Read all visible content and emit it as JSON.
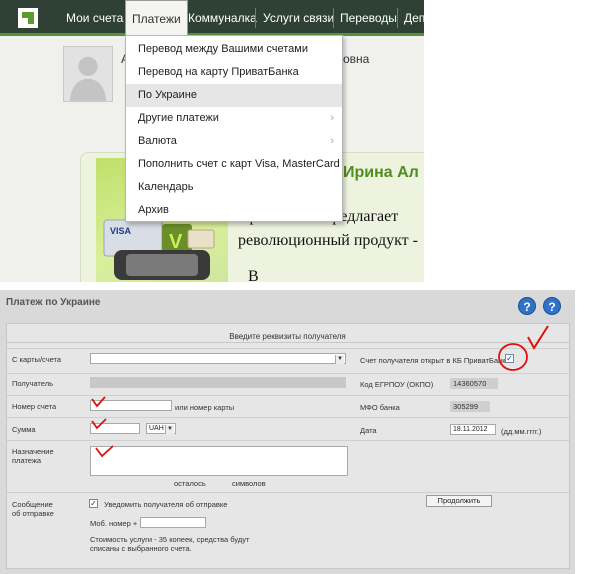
{
  "nav": {
    "items": [
      "Мои счета",
      "Платежи",
      "Коммуналка",
      "Услуги связи",
      "Переводы",
      "Деп"
    ],
    "active_index": 1
  },
  "dropdown": {
    "items": [
      {
        "label": "Перевод между Вашими счетами",
        "has_submenu": false
      },
      {
        "label": "Перевод на карту ПриватБанка",
        "has_submenu": false
      },
      {
        "label": "По Украине",
        "has_submenu": false,
        "highlighted": true
      },
      {
        "label": "Другие платежи",
        "has_submenu": true
      },
      {
        "label": "Валюта",
        "has_submenu": true
      },
      {
        "label": "Пополнить счет с карт Visa, MasterCard",
        "has_submenu": false
      },
      {
        "label": "Календарь",
        "has_submenu": false
      },
      {
        "label": "Архив",
        "has_submenu": false
      }
    ]
  },
  "profile": {
    "name_fragment_left": "А",
    "name_fragment_right": "овна"
  },
  "banner": {
    "name": "Ирина Ал",
    "text_line1": "ПриватБанк предлагает",
    "text_line2": "революционный продукт -",
    "text_line3": "В"
  },
  "form": {
    "title": "Платеж по Украине",
    "heading": "Введите реквизиты получателя",
    "help_icon_1": "?",
    "help_icon_2": "?",
    "labels": {
      "from_card": "С карты/счета",
      "recipient": "Получатель",
      "account_number": "Номер счета",
      "or_card_number": "или номер карты",
      "amount": "Сумма",
      "purpose_line1": "Назначение",
      "purpose_line2": "платежа",
      "remaining": "осталось",
      "symbols": "символов",
      "account_in_privat": "Счет получателя открыт в КБ ПриватБанк",
      "edrpou": "Код ЕГРПОУ (ОКПО)",
      "mfo": "МФО банка",
      "date": "Дата",
      "date_format": "(дд.мм.гггг.)",
      "message_line1": "Сообщение",
      "message_line2": "об отправке",
      "notify_recipient": "Уведомить получателя об отправке",
      "mobile": "Моб. номер +",
      "cost_line1": "Стоимость услуги - 35 копеек, средства будут",
      "cost_line2": "списаны с выбранного счета."
    },
    "values": {
      "currency": "UAH",
      "edrpou": "14360570",
      "mfo": "305299",
      "date": "18.11.2012",
      "account_in_privat_checked": "✓",
      "notify_checked": "✓"
    },
    "continue_button": "Продолжить"
  }
}
